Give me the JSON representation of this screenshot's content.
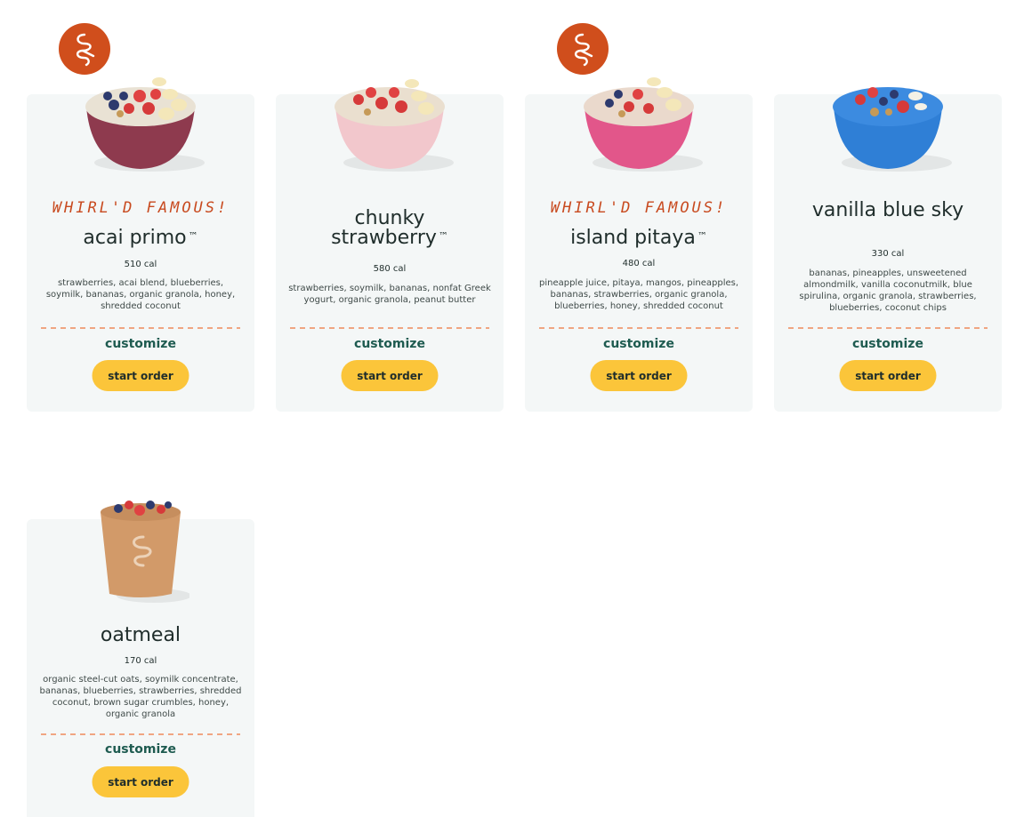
{
  "famous_label": "WHIRL'D FAMOUS!",
  "trademark": "™",
  "cards": [
    {
      "name": "acai primo",
      "trademark": true,
      "famous": true,
      "calories": "510 cal",
      "description": "strawberries, acai blend, blueberries, soymilk, bananas, organic granola, honey, shredded coconut",
      "customize_label": "customize",
      "order_label": "start order"
    },
    {
      "name": "chunky strawberry",
      "trademark": true,
      "famous": false,
      "calories": "580 cal",
      "description": "strawberries, soymilk, bananas, nonfat Greek yogurt, organic granola, peanut butter",
      "customize_label": "customize",
      "order_label": "start order"
    },
    {
      "name": "island pitaya",
      "trademark": true,
      "famous": true,
      "calories": "480 cal",
      "description": "pineapple juice, pitaya, mangos, pineapples, bananas, strawberries, organic granola, blueberries, honey, shredded coconut",
      "customize_label": "customize",
      "order_label": "start order"
    },
    {
      "name": "vanilla blue sky",
      "trademark": false,
      "famous": false,
      "calories": "330 cal",
      "description": "bananas, pineapples, unsweetened almondmilk, vanilla coconutmilk, blue spirulina, organic granola, strawberries, blueberries, coconut chips",
      "customize_label": "customize",
      "order_label": "start order"
    },
    {
      "name": "oatmeal",
      "trademark": false,
      "famous": false,
      "calories": "170 cal",
      "description": "organic steel-cut oats, soymilk concentrate, bananas, blueberries, strawberries, shredded coconut, brown sugar crumbles, honey, organic granola",
      "customize_label": "customize",
      "order_label": "start order"
    }
  ],
  "colors": {
    "accent_orange": "#d04e1c",
    "button_yellow": "#fbc53a",
    "customize_green": "#1e5b50",
    "card_bg": "#f4f7f7",
    "acai_bowl": "#8e3a4e",
    "strawberry_bowl": "#f2c7cc",
    "pitaya_bowl": "#e2568a",
    "blue_sky_bowl": "#2f7fd6",
    "oatmeal_cup": "#d29a69"
  },
  "icons": {
    "badge": "swirl-logo-icon"
  }
}
